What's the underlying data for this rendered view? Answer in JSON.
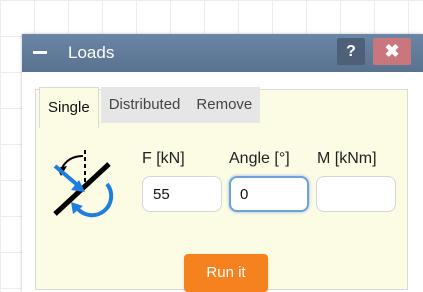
{
  "window": {
    "title": "Loads",
    "help_label": "?",
    "close_label": "✖"
  },
  "tabs": [
    {
      "label": "Single",
      "active": true
    },
    {
      "label": "Distributed",
      "active": false
    },
    {
      "label": "Remove",
      "active": false
    }
  ],
  "fields": {
    "force": {
      "label": "F [kN]",
      "value": "55"
    },
    "angle": {
      "label": "Angle [°]",
      "value": "0"
    },
    "moment": {
      "label": "M [kNm]",
      "value": ""
    }
  },
  "run_button": {
    "label": "Run it"
  },
  "icons": {
    "minimize": "minimize-icon",
    "load": "load-icon"
  },
  "colors": {
    "titlebar": "#5f7a99",
    "panel": "#fcfbe3",
    "run_button": "#f6821f",
    "icon_blue": "#1d7de0",
    "close": "#c9777c"
  }
}
